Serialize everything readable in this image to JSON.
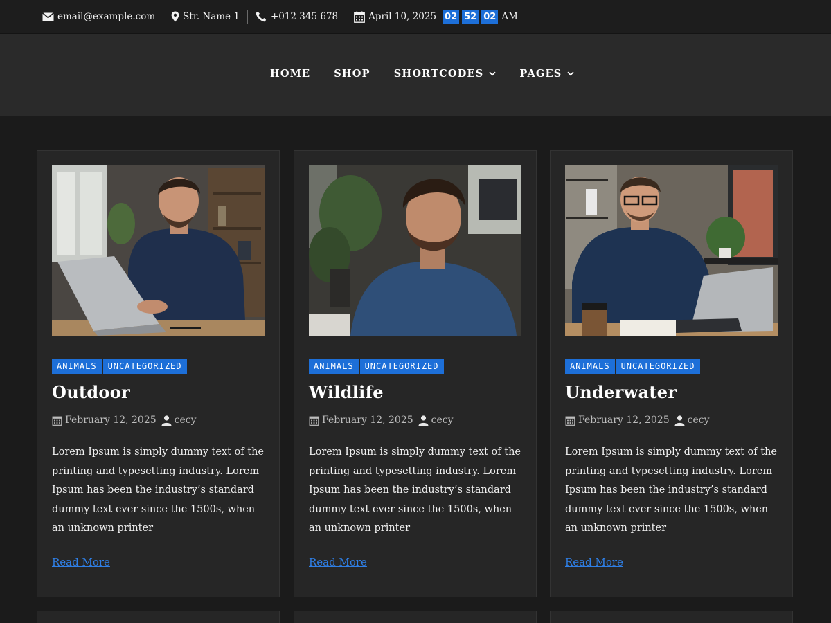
{
  "topbar": {
    "email": "email@example.com",
    "address": "Str. Name 1",
    "phone": "+012 345 678",
    "date": "April 10, 2025",
    "clock": {
      "hours": "02",
      "minutes": "52",
      "seconds": "02",
      "ampm": "AM"
    },
    "icons": [
      "envelope-icon",
      "map-pin-icon",
      "phone-icon",
      "calendar-icon"
    ]
  },
  "nav": {
    "items": [
      {
        "label": "HOME",
        "has_dropdown": false
      },
      {
        "label": "SHOP",
        "has_dropdown": false
      },
      {
        "label": "SHORTCODES",
        "has_dropdown": true
      },
      {
        "label": "PAGES",
        "has_dropdown": true
      }
    ]
  },
  "posts": [
    {
      "tags": [
        "ANIMALS",
        "UNCATEGORIZED"
      ],
      "title": "Outdoor",
      "date": "February 12, 2025",
      "author": "cecy",
      "excerpt": "Lorem Ipsum is simply dummy text of the printing and typesetting industry. Lorem Ipsum has been the industry’s standard dummy text ever since the 1500s, when an unknown printer",
      "read_more": "Read More"
    },
    {
      "tags": [
        "ANIMALS",
        "UNCATEGORIZED"
      ],
      "title": "Wildlife",
      "date": "February 12, 2025",
      "author": "cecy",
      "excerpt": "Lorem Ipsum is simply dummy text of the printing and typesetting industry. Lorem Ipsum has been the industry’s standard dummy text ever since the 1500s, when an unknown printer",
      "read_more": "Read More"
    },
    {
      "tags": [
        "ANIMALS",
        "UNCATEGORIZED"
      ],
      "title": "Underwater",
      "date": "February 12, 2025",
      "author": "cecy",
      "excerpt": "Lorem Ipsum is simply dummy text of the printing and typesetting industry. Lorem Ipsum has been the industry’s standard dummy text ever since the 1500s, when an unknown printer",
      "read_more": "Read More"
    }
  ],
  "colors": {
    "accent": "#1d6fd8",
    "link": "#2f7fe6",
    "page_bg": "#1b1b1b",
    "nav_bg": "#2a2a2a",
    "card_bg": "#262626"
  }
}
